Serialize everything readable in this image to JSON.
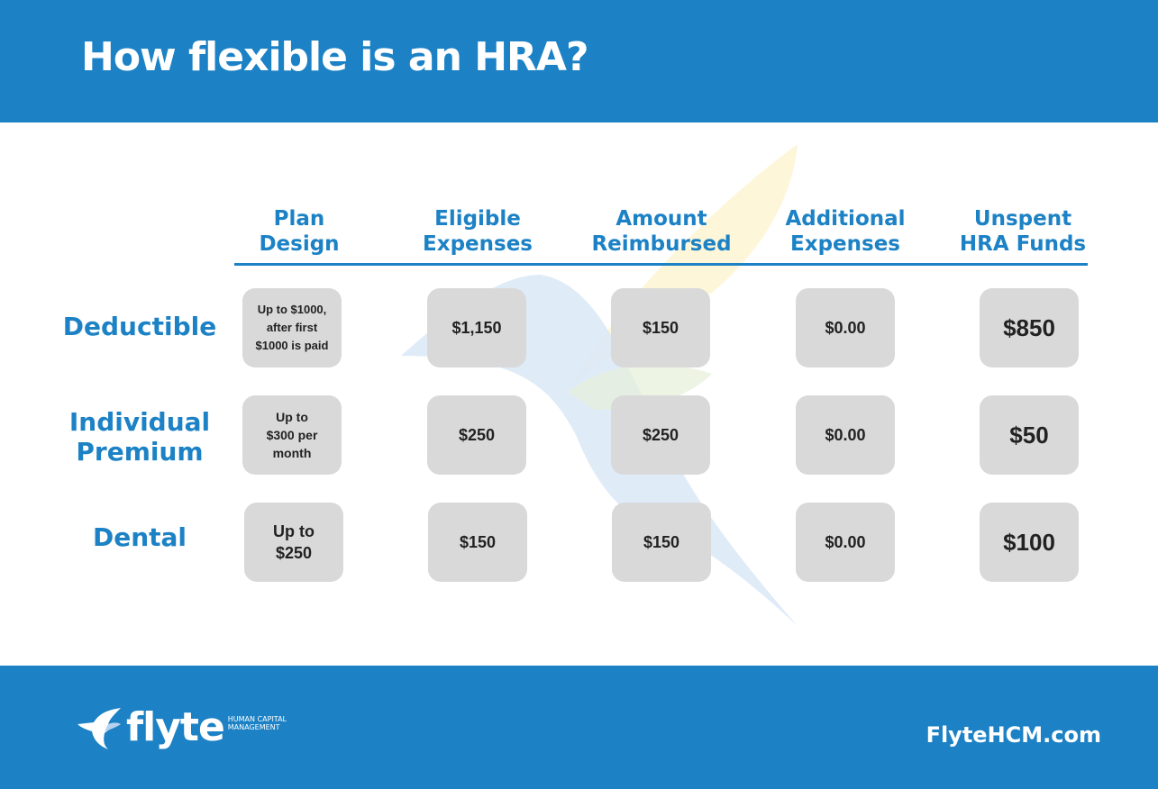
{
  "header": {
    "title": "How flexible is an HRA?"
  },
  "table": {
    "columns": [
      "Plan\nDesign",
      "Eligible\nExpenses",
      "Amount\nReimbursed",
      "Additional\nExpenses",
      "Unspent\nHRA Funds"
    ],
    "rows": [
      {
        "label": "Deductible",
        "cells": [
          "Up to $1000,\nafter first\n$1000 is paid",
          "$1,150",
          "$150",
          "$0.00",
          "$850"
        ]
      },
      {
        "label": "Individual\nPremium",
        "cells": [
          "Up to\n$300 per\nmonth",
          "$250",
          "$250",
          "$0.00",
          "$50"
        ]
      },
      {
        "label": "Dental",
        "cells": [
          "Up to\n$250",
          "$150",
          "$150",
          "$0.00",
          "$100"
        ]
      }
    ]
  },
  "footer": {
    "logo_text": "flyte",
    "logo_sub": "HUMAN CAPITAL\nMANAGEMENT",
    "website": "FlyteHCM.com"
  },
  "colors": {
    "brand_blue": "#1c82c5",
    "cell_gray": "#d9d9d9"
  }
}
